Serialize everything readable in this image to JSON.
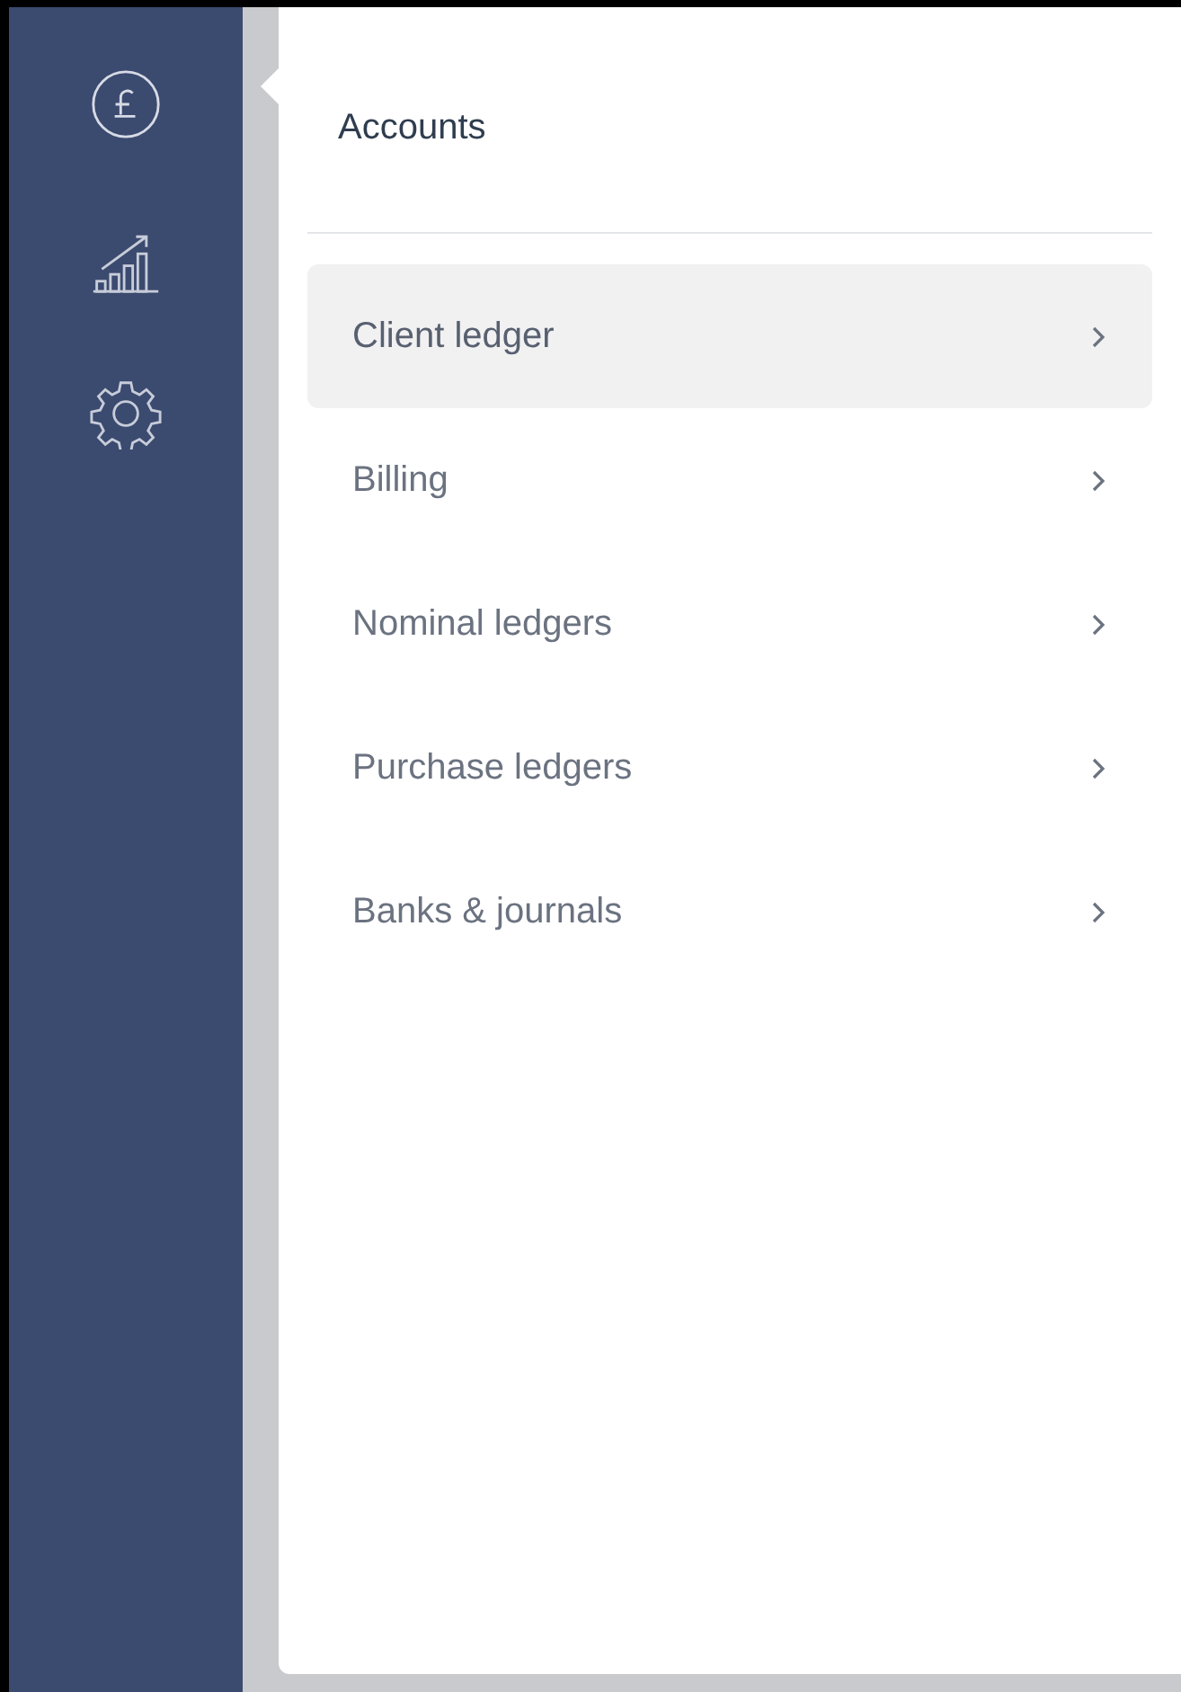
{
  "sidebar": {
    "items": [
      {
        "kind": "pound",
        "selected": true
      },
      {
        "kind": "chart",
        "selected": false
      },
      {
        "kind": "gear",
        "selected": false
      }
    ]
  },
  "menu": {
    "title": "Accounts",
    "items": [
      {
        "label": "Client ledger",
        "selected": true
      },
      {
        "label": "Billing",
        "selected": false
      },
      {
        "label": "Nominal ledgers",
        "selected": false
      },
      {
        "label": "Purchase ledgers",
        "selected": false
      },
      {
        "label": "Banks & journals",
        "selected": false
      }
    ]
  }
}
